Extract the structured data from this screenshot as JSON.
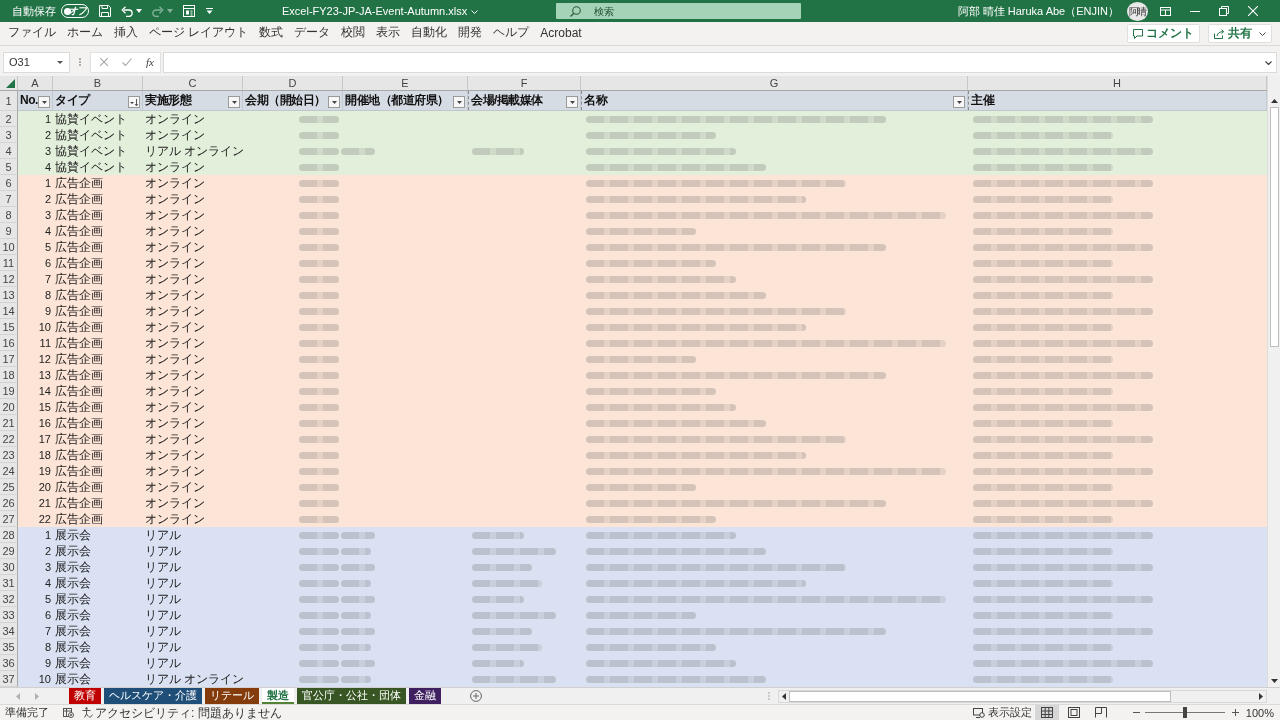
{
  "title_bar": {
    "autosave": {
      "label": "自動保存",
      "on": false,
      "state_text": "オフ"
    },
    "quick_access": [
      {
        "kind": "save",
        "disabled": false
      },
      {
        "kind": "undo",
        "disabled": false
      },
      {
        "kind": "redo",
        "disabled": true
      },
      {
        "kind": "form",
        "disabled": false
      }
    ],
    "file_name": "Excel-FY23-JP-JA-Event-Autumn.xlsx",
    "search": {
      "placeholder": "検索"
    },
    "user": {
      "name": "阿部 晴佳 Haruka Abe（ENJIN）",
      "initials": "阿晴"
    }
  },
  "ribbon": {
    "tabs": [
      {
        "label": "ファイル",
        "selected": false
      },
      {
        "label": "ホーム",
        "selected": false
      },
      {
        "label": "挿入",
        "selected": false
      },
      {
        "label": "ページ レイアウト",
        "selected": false
      },
      {
        "label": "数式",
        "selected": false
      },
      {
        "label": "データ",
        "selected": false
      },
      {
        "label": "校閲",
        "selected": false
      },
      {
        "label": "表示",
        "selected": false
      },
      {
        "label": "自動化",
        "selected": false
      },
      {
        "label": "開発",
        "selected": false
      },
      {
        "label": "ヘルプ",
        "selected": false
      },
      {
        "label": "Acrobat",
        "selected": false
      }
    ],
    "comment_button": "コメント",
    "share_button": "共有"
  },
  "formula_bar": {
    "name_box": "O31",
    "function_label": "fx"
  },
  "sheet": {
    "columns": [
      {
        "letter": "A",
        "header": "No.",
        "filter": true,
        "sorted": false
      },
      {
        "letter": "B",
        "header": "タイプ",
        "filter": true,
        "sorted": true
      },
      {
        "letter": "C",
        "header": "実施形態",
        "filter": true,
        "sorted": false
      },
      {
        "letter": "D",
        "header": "会期（開始日）",
        "filter": true,
        "sorted": false
      },
      {
        "letter": "E",
        "header": "開催地（都道府県）",
        "filter": true,
        "sorted": false
      },
      {
        "letter": "F",
        "header": "会場/掲載媒体",
        "filter": true,
        "sorted": false
      },
      {
        "letter": "G",
        "header": "名称",
        "filter": true,
        "sorted": false
      },
      {
        "letter": "H",
        "header": "主催",
        "filter": false
      }
    ],
    "header_row": "1",
    "rows": [
      {
        "row": "2",
        "cells": [
          "1",
          "協賛イベント",
          "オンライン"
        ],
        "blurred": [
          true,
          false,
          false,
          true,
          true
        ],
        "color": "#e2efda"
      },
      {
        "row": "3",
        "cells": [
          "2",
          "協賛イベント",
          "オンライン"
        ],
        "blurred": [
          true,
          false,
          false,
          true,
          true
        ],
        "color": "#e2efda"
      },
      {
        "row": "4",
        "cells": [
          "3",
          "協賛イベント",
          "リアル オンライン"
        ],
        "blurred": [
          true,
          true,
          true,
          true,
          true
        ],
        "color": "#e2efda"
      },
      {
        "row": "5",
        "cells": [
          "4",
          "協賛イベント",
          "オンライン"
        ],
        "blurred": [
          true,
          false,
          false,
          true,
          true
        ],
        "color": "#e2efda"
      },
      {
        "row": "6",
        "cells": [
          "1",
          "広告企画",
          "オンライン"
        ],
        "blurred": [
          true,
          false,
          false,
          true,
          true
        ],
        "color": "#fce4d6"
      },
      {
        "row": "7",
        "cells": [
          "2",
          "広告企画",
          "オンライン"
        ],
        "blurred": [
          true,
          false,
          false,
          true,
          true
        ],
        "color": "#fce4d6"
      },
      {
        "row": "8",
        "cells": [
          "3",
          "広告企画",
          "オンライン"
        ],
        "blurred": [
          true,
          false,
          false,
          true,
          true
        ],
        "color": "#fce4d6"
      },
      {
        "row": "9",
        "cells": [
          "4",
          "広告企画",
          "オンライン"
        ],
        "blurred": [
          true,
          false,
          false,
          true,
          true
        ],
        "color": "#fce4d6"
      },
      {
        "row": "10",
        "cells": [
          "5",
          "広告企画",
          "オンライン"
        ],
        "blurred": [
          true,
          false,
          false,
          true,
          true
        ],
        "color": "#fce4d6"
      },
      {
        "row": "11",
        "cells": [
          "6",
          "広告企画",
          "オンライン"
        ],
        "blurred": [
          true,
          false,
          false,
          true,
          true
        ],
        "color": "#fce4d6"
      },
      {
        "row": "12",
        "cells": [
          "7",
          "広告企画",
          "オンライン"
        ],
        "blurred": [
          true,
          false,
          false,
          true,
          true
        ],
        "color": "#fce4d6"
      },
      {
        "row": "13",
        "cells": [
          "8",
          "広告企画",
          "オンライン"
        ],
        "blurred": [
          true,
          false,
          false,
          true,
          true
        ],
        "color": "#fce4d6"
      },
      {
        "row": "14",
        "cells": [
          "9",
          "広告企画",
          "オンライン"
        ],
        "blurred": [
          true,
          false,
          false,
          true,
          true
        ],
        "color": "#fce4d6"
      },
      {
        "row": "15",
        "cells": [
          "10",
          "広告企画",
          "オンライン"
        ],
        "blurred": [
          true,
          false,
          false,
          true,
          true
        ],
        "color": "#fce4d6"
      },
      {
        "row": "16",
        "cells": [
          "11",
          "広告企画",
          "オンライン"
        ],
        "blurred": [
          true,
          false,
          false,
          true,
          true
        ],
        "color": "#fce4d6"
      },
      {
        "row": "17",
        "cells": [
          "12",
          "広告企画",
          "オンライン"
        ],
        "blurred": [
          true,
          false,
          false,
          true,
          true
        ],
        "color": "#fce4d6"
      },
      {
        "row": "18",
        "cells": [
          "13",
          "広告企画",
          "オンライン"
        ],
        "blurred": [
          true,
          false,
          false,
          true,
          true
        ],
        "color": "#fce4d6"
      },
      {
        "row": "19",
        "cells": [
          "14",
          "広告企画",
          "オンライン"
        ],
        "blurred": [
          true,
          false,
          false,
          true,
          true
        ],
        "color": "#fce4d6"
      },
      {
        "row": "20",
        "cells": [
          "15",
          "広告企画",
          "オンライン"
        ],
        "blurred": [
          true,
          false,
          false,
          true,
          true
        ],
        "color": "#fce4d6"
      },
      {
        "row": "21",
        "cells": [
          "16",
          "広告企画",
          "オンライン"
        ],
        "blurred": [
          true,
          false,
          false,
          true,
          true
        ],
        "color": "#fce4d6"
      },
      {
        "row": "22",
        "cells": [
          "17",
          "広告企画",
          "オンライン"
        ],
        "blurred": [
          true,
          false,
          false,
          true,
          true
        ],
        "color": "#fce4d6"
      },
      {
        "row": "23",
        "cells": [
          "18",
          "広告企画",
          "オンライン"
        ],
        "blurred": [
          true,
          false,
          false,
          true,
          true
        ],
        "color": "#fce4d6"
      },
      {
        "row": "24",
        "cells": [
          "19",
          "広告企画",
          "オンライン"
        ],
        "blurred": [
          true,
          false,
          false,
          true,
          true
        ],
        "color": "#fce4d6"
      },
      {
        "row": "25",
        "cells": [
          "20",
          "広告企画",
          "オンライン"
        ],
        "blurred": [
          true,
          false,
          false,
          true,
          true
        ],
        "color": "#fce4d6"
      },
      {
        "row": "26",
        "cells": [
          "21",
          "広告企画",
          "オンライン"
        ],
        "blurred": [
          true,
          false,
          false,
          true,
          true
        ],
        "color": "#fce4d6"
      },
      {
        "row": "27",
        "cells": [
          "22",
          "広告企画",
          "オンライン"
        ],
        "blurred": [
          true,
          false,
          false,
          true,
          true
        ],
        "color": "#fce4d6"
      },
      {
        "row": "28",
        "cells": [
          "1",
          "展示会",
          "リアル"
        ],
        "blurred": [
          true,
          true,
          true,
          true,
          true
        ],
        "color": "#d9e1f2"
      },
      {
        "row": "29",
        "cells": [
          "2",
          "展示会",
          "リアル"
        ],
        "blurred": [
          true,
          true,
          true,
          true,
          true
        ],
        "color": "#d9e1f2"
      },
      {
        "row": "30",
        "cells": [
          "3",
          "展示会",
          "リアル"
        ],
        "blurred": [
          true,
          true,
          true,
          true,
          true
        ],
        "color": "#d9e1f2"
      },
      {
        "row": "31",
        "cells": [
          "4",
          "展示会",
          "リアル"
        ],
        "blurred": [
          true,
          true,
          true,
          true,
          true
        ],
        "color": "#d9e1f2"
      },
      {
        "row": "32",
        "cells": [
          "5",
          "展示会",
          "リアル"
        ],
        "blurred": [
          true,
          true,
          true,
          true,
          true
        ],
        "color": "#d9e1f2"
      },
      {
        "row": "33",
        "cells": [
          "6",
          "展示会",
          "リアル"
        ],
        "blurred": [
          true,
          true,
          true,
          true,
          true
        ],
        "color": "#d9e1f2"
      },
      {
        "row": "34",
        "cells": [
          "7",
          "展示会",
          "リアル"
        ],
        "blurred": [
          true,
          true,
          true,
          true,
          true
        ],
        "color": "#d9e1f2"
      },
      {
        "row": "35",
        "cells": [
          "8",
          "展示会",
          "リアル"
        ],
        "blurred": [
          true,
          true,
          true,
          true,
          true
        ],
        "color": "#d9e1f2"
      },
      {
        "row": "36",
        "cells": [
          "9",
          "展示会",
          "リアル"
        ],
        "blurred": [
          true,
          true,
          true,
          true,
          true
        ],
        "color": "#d9e1f2"
      },
      {
        "row": "37",
        "cells": [
          "10",
          "展示会",
          "リアル オンライン"
        ],
        "blurred": [
          true,
          true,
          true,
          true,
          true
        ],
        "color": "#d9e1f2"
      }
    ]
  },
  "sheet_tabs": [
    {
      "label": "教育",
      "color": "#c00000",
      "selected": false
    },
    {
      "label": "ヘルスケア・介護",
      "color": "#1f4e78",
      "selected": false
    },
    {
      "label": "リテール",
      "color": "#843c0c",
      "selected": false
    },
    {
      "label": "製造",
      "color": "#548235",
      "selected": true
    },
    {
      "label": "官公庁・公社・団体",
      "color": "#375623",
      "selected": false
    },
    {
      "label": "金融",
      "color": "#3f1f5f",
      "selected": false
    }
  ],
  "status_bar": {
    "ready": "準備完了",
    "accessibility": "アクセシビリティ: 問題ありません",
    "display_settings": "表示設定",
    "views": [
      {
        "kind": "normal",
        "selected": true
      },
      {
        "kind": "page_layout",
        "selected": false
      },
      {
        "kind": "page_break",
        "selected": false
      }
    ],
    "zoom": {
      "level": 0.5,
      "reading": "100%"
    }
  }
}
